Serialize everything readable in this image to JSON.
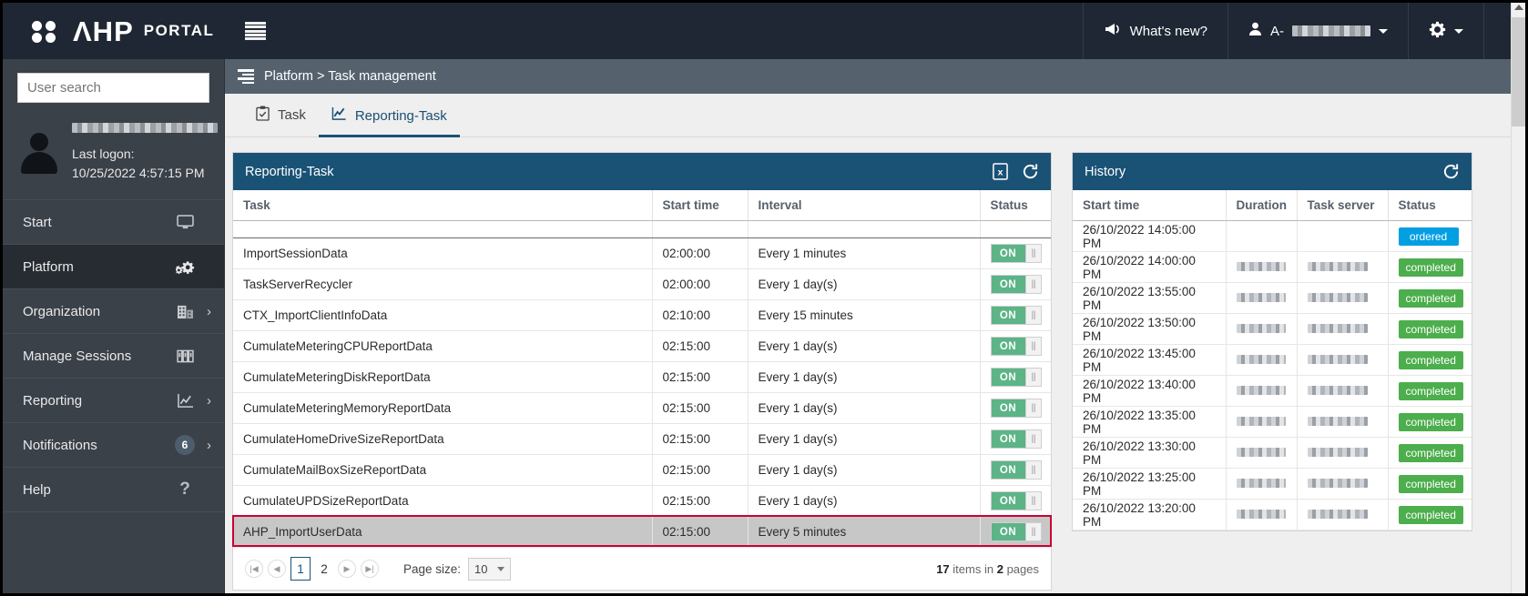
{
  "topbar": {
    "brand": "ΛHP",
    "brand_sub": "PORTAL",
    "menu_icon": "hamburger-icon",
    "whats_new": "What's new?",
    "user_prefix": "A-",
    "user_redacted": true
  },
  "sidebar": {
    "search_placeholder": "User search",
    "profile": {
      "name_redacted": true,
      "last_logon_label": "Last logon:",
      "last_logon_value": "10/25/2022 4:57:15 PM"
    },
    "items": [
      {
        "label": "Start",
        "icon": "monitor-icon",
        "arrow": false,
        "active": false,
        "badge": null
      },
      {
        "label": "Platform",
        "icon": "gears-icon",
        "arrow": false,
        "active": true,
        "badge": null
      },
      {
        "label": "Organization",
        "icon": "building-icon",
        "arrow": true,
        "active": false,
        "badge": null
      },
      {
        "label": "Manage Sessions",
        "icon": "servers-icon",
        "arrow": false,
        "active": false,
        "badge": null
      },
      {
        "label": "Reporting",
        "icon": "chart-icon",
        "arrow": true,
        "active": false,
        "badge": null
      },
      {
        "label": "Notifications",
        "icon": "bell-icon",
        "arrow": true,
        "active": false,
        "badge": "6"
      },
      {
        "label": "Help",
        "icon": "question-icon",
        "arrow": false,
        "active": false,
        "badge": null
      }
    ]
  },
  "breadcrumb": "Platform > Task management",
  "tabs": [
    {
      "label": "Task",
      "icon": "clipboard-check-icon",
      "active": false
    },
    {
      "label": "Reporting-Task",
      "icon": "line-chart-icon",
      "active": true
    }
  ],
  "reporting_task_panel": {
    "title": "Reporting-Task",
    "export_icon": "excel-export-icon",
    "refresh_icon": "refresh-icon",
    "columns": [
      "Task",
      "Start time",
      "Interval",
      "Status"
    ],
    "rows": [
      {
        "task": "ImportSessionData",
        "start": "02:00:00",
        "interval": "Every 1 minutes",
        "status": "ON",
        "selected": false
      },
      {
        "task": "TaskServerRecycler",
        "start": "02:00:00",
        "interval": "Every 1 day(s)",
        "status": "ON",
        "selected": false
      },
      {
        "task": "CTX_ImportClientInfoData",
        "start": "02:10:00",
        "interval": "Every 15 minutes",
        "status": "ON",
        "selected": false
      },
      {
        "task": "CumulateMeteringCPUReportData",
        "start": "02:15:00",
        "interval": "Every 1 day(s)",
        "status": "ON",
        "selected": false
      },
      {
        "task": "CumulateMeteringDiskReportData",
        "start": "02:15:00",
        "interval": "Every 1 day(s)",
        "status": "ON",
        "selected": false
      },
      {
        "task": "CumulateMeteringMemoryReportData",
        "start": "02:15:00",
        "interval": "Every 1 day(s)",
        "status": "ON",
        "selected": false
      },
      {
        "task": "CumulateHomeDriveSizeReportData",
        "start": "02:15:00",
        "interval": "Every 1 day(s)",
        "status": "ON",
        "selected": false
      },
      {
        "task": "CumulateMailBoxSizeReportData",
        "start": "02:15:00",
        "interval": "Every 1 day(s)",
        "status": "ON",
        "selected": false
      },
      {
        "task": "CumulateUPDSizeReportData",
        "start": "02:15:00",
        "interval": "Every 1 day(s)",
        "status": "ON",
        "selected": false
      },
      {
        "task": "AHP_ImportUserData",
        "start": "02:15:00",
        "interval": "Every 5 minutes",
        "status": "ON",
        "selected": true
      }
    ],
    "pager": {
      "first_icon": "first-page-icon",
      "prev_icon": "prev-page-icon",
      "next_icon": "next-page-icon",
      "last_icon": "last-page-icon",
      "pages": [
        "1",
        "2"
      ],
      "current_page": "1",
      "page_size_label": "Page size:",
      "page_size_value": "10",
      "items_count": "17",
      "items_word": "items in",
      "pages_count": "2",
      "pages_word": "pages"
    }
  },
  "history_panel": {
    "title": "History",
    "refresh_icon": "refresh-icon",
    "columns": [
      "Start time",
      "Duration",
      "Task server",
      "Status"
    ],
    "rows": [
      {
        "start": "26/10/2022 14:05:00 PM",
        "duration": "",
        "server": "",
        "status": "ordered",
        "status_kind": "ordered"
      },
      {
        "start": "26/10/2022 14:00:00 PM",
        "duration": "redacted",
        "server": "redacted",
        "status": "completed",
        "status_kind": "completed"
      },
      {
        "start": "26/10/2022 13:55:00 PM",
        "duration": "redacted",
        "server": "redacted",
        "status": "completed",
        "status_kind": "completed"
      },
      {
        "start": "26/10/2022 13:50:00 PM",
        "duration": "redacted",
        "server": "redacted",
        "status": "completed",
        "status_kind": "completed"
      },
      {
        "start": "26/10/2022 13:45:00 PM",
        "duration": "redacted",
        "server": "redacted",
        "status": "completed",
        "status_kind": "completed"
      },
      {
        "start": "26/10/2022 13:40:00 PM",
        "duration": "redacted",
        "server": "redacted",
        "status": "completed",
        "status_kind": "completed"
      },
      {
        "start": "26/10/2022 13:35:00 PM",
        "duration": "redacted",
        "server": "redacted",
        "status": "completed",
        "status_kind": "completed"
      },
      {
        "start": "26/10/2022 13:30:00 PM",
        "duration": "redacted",
        "server": "redacted",
        "status": "completed",
        "status_kind": "completed"
      },
      {
        "start": "26/10/2022 13:25:00 PM",
        "duration": "redacted",
        "server": "redacted",
        "status": "completed",
        "status_kind": "completed"
      },
      {
        "start": "26/10/2022 13:20:00 PM",
        "duration": "redacted",
        "server": "redacted",
        "status": "completed",
        "status_kind": "completed"
      }
    ]
  },
  "colors": {
    "topbar_bg": "#1e2733",
    "sidebar_bg": "#3b4149",
    "panel_header": "#1a5276",
    "breadcrumb_bg": "#55626e",
    "toggle_on": "#5cb487",
    "status_completed": "#4cae4c",
    "status_ordered": "#029fe3",
    "selection_outline": "#cc0033"
  }
}
